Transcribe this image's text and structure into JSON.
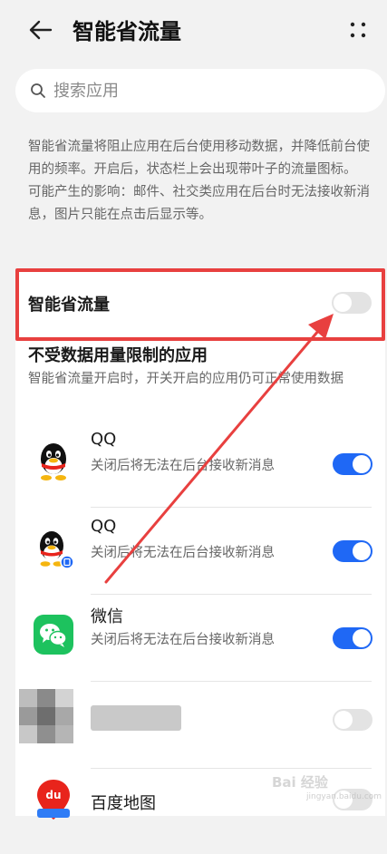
{
  "header": {
    "title": "智能省流量",
    "back_icon": "arrow-left-icon",
    "more_icon": "more-vertical-icon"
  },
  "search": {
    "placeholder": "搜索应用",
    "value": ""
  },
  "description": {
    "line1": "智能省流量将阻止应用在后台使用移动数据，并降低前台使用的频率。开启后，状态栏上会出现带叶子的流量图标。",
    "line2": "可能产生的影响：邮件、社交类应用在后台时无法接收新消息，图片只能在点击后显示等。"
  },
  "main_toggle": {
    "label": "智能省流量",
    "state": "off"
  },
  "unrestricted_section": {
    "title": "不受数据用量限制的应用",
    "desc": "智能省流量开启时，开关开启的应用仍可正常使用数据"
  },
  "apps": [
    {
      "name": "QQ",
      "sub": "关闭后将无法在后台接收新消息",
      "toggle": "on",
      "icon": "qq-penguin-icon"
    },
    {
      "name": "QQ",
      "sub": "关闭后将无法在后台接收新消息",
      "toggle": "on",
      "icon": "qq-penguin-clone-icon"
    },
    {
      "name": "微信",
      "sub": "关闭后将无法在后台接收新消息",
      "toggle": "on",
      "icon": "wechat-icon"
    },
    {
      "name": "",
      "sub": "",
      "toggle": "off",
      "icon": "blurred-app-icon"
    },
    {
      "name": "百度地图",
      "sub": "",
      "toggle": "off",
      "icon": "baidu-map-icon"
    }
  ],
  "watermark": {
    "text": "Bai 经验",
    "sub": "jingyan.baidu.com"
  },
  "colors": {
    "accent": "#1f68f5",
    "highlight": "#e8403f",
    "background": "#f2f2f2"
  }
}
